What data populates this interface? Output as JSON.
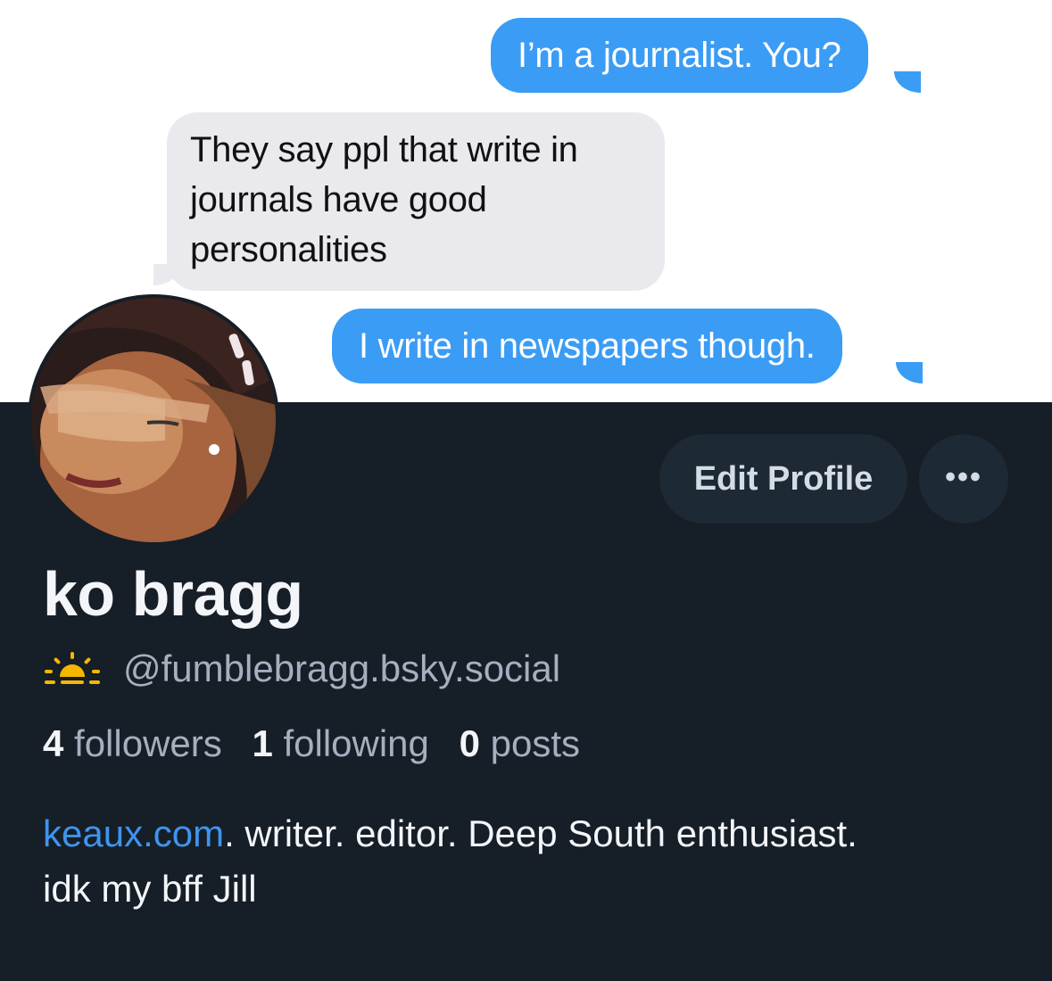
{
  "messages": [
    {
      "direction": "outgoing",
      "text": "I’m a journalist. You?"
    },
    {
      "direction": "incoming",
      "lines": [
        "They say ppl that write in",
        "journals have good",
        "personalities"
      ]
    },
    {
      "direction": "outgoing",
      "text": "I write in newspapers though."
    }
  ],
  "profile": {
    "display_name": "ko bragg",
    "handle": "@fumblebragg.bsky.social",
    "handle_icon": "sunrise-icon",
    "stats": {
      "followers_count": "4",
      "followers_label": "followers",
      "following_count": "1",
      "following_label": "following",
      "posts_count": "0",
      "posts_label": "posts"
    },
    "bio": {
      "link_text": "keaux.com",
      "rest_line1": ". writer. editor. Deep South enthusiast.",
      "line2": "idk my bff Jill"
    }
  },
  "actions": {
    "edit_profile_label": "Edit Profile",
    "more_label": "•••"
  },
  "colors": {
    "background": "#161e27",
    "outgoing_bubble": "#3a9cf5",
    "incoming_bubble": "#e9e9ee",
    "link": "#3f94ee",
    "icon_yellow": "#f5b800"
  }
}
